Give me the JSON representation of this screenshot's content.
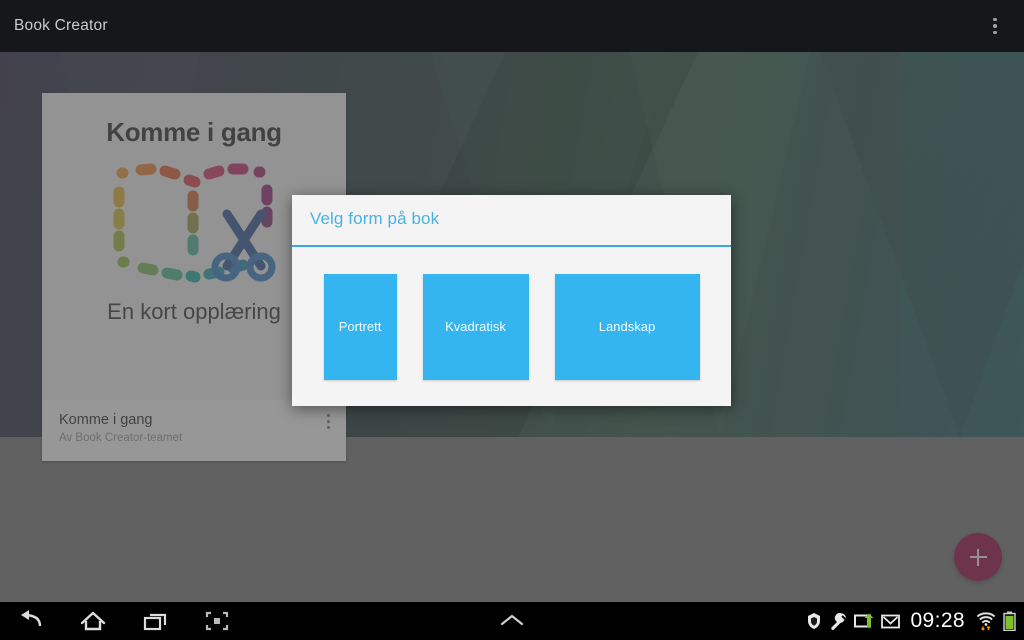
{
  "appbar": {
    "title": "Book Creator",
    "overflow_icon": "overflow-menu-icon"
  },
  "book_card": {
    "cover_title": "Komme i gang",
    "cover_subtitle": "En kort opplæring",
    "logo_icon": "book-scissors-logo-icon",
    "footer_title": "Komme i gang",
    "footer_subtitle": "Av Book Creator-teamet",
    "overflow_icon": "overflow-menu-icon"
  },
  "dialog": {
    "title": "Velg form på bok",
    "accent_color": "#3aa7e0",
    "title_color": "#4ab3e4",
    "option_color": "#35b5ef",
    "options": [
      {
        "label": "Portrett",
        "shape": "portrait"
      },
      {
        "label": "Kvadratisk",
        "shape": "square"
      },
      {
        "label": "Landskap",
        "shape": "landscape"
      }
    ]
  },
  "fab": {
    "label": "+",
    "icon": "plus-icon",
    "color": "#8b0037"
  },
  "system_bar": {
    "nav_icons": [
      {
        "name": "back-icon"
      },
      {
        "name": "home-icon"
      },
      {
        "name": "recent-apps-icon"
      },
      {
        "name": "screenshot-icon"
      }
    ],
    "center_icon": "chevron-up-icon",
    "status_icons": [
      {
        "name": "shield-icon"
      },
      {
        "name": "wrench-icon"
      },
      {
        "name": "usb-transfer-icon"
      },
      {
        "name": "gmail-icon"
      }
    ],
    "clock": "09:28",
    "trailing_icons": [
      {
        "name": "wifi-icon"
      },
      {
        "name": "battery-icon"
      }
    ]
  }
}
